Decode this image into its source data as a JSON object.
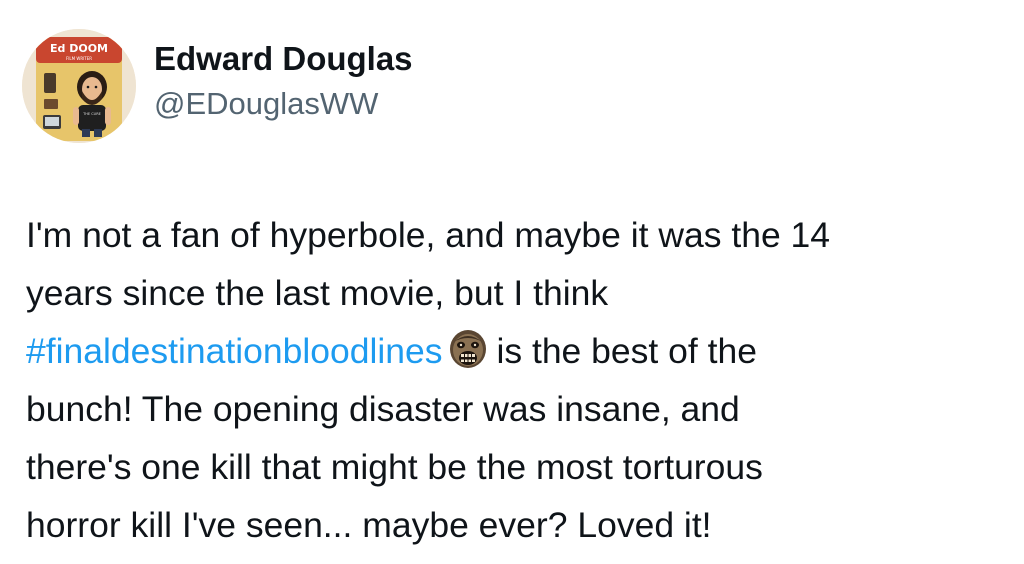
{
  "author": {
    "display_name": "Edward Douglas",
    "handle": "@EDouglasWW",
    "avatar": {
      "icon": "action-figure-avatar-icon",
      "box_title": "Ed DOOM",
      "box_subtitle": "FILM WRITER",
      "shirt_text": "THE CURE"
    }
  },
  "tweet": {
    "lines": [
      {
        "before": "I'm not a fan of hyperbole, and maybe it was the 14"
      },
      {
        "before": "years since the last movie, but I think"
      },
      {
        "hashtag": "#finaldestinationbloodlines",
        "emoji": "skull-face-emoji-icon",
        "after": "is the best of the"
      },
      {
        "before": "bunch! The opening disaster was insane, and"
      },
      {
        "before": "there's one kill that might be the most torturous"
      },
      {
        "before": "horror kill I've seen... maybe ever? Loved it!"
      }
    ]
  },
  "colors": {
    "hashtag": "#1d9bf0",
    "text": "#0f1419",
    "secondary": "#536471"
  }
}
